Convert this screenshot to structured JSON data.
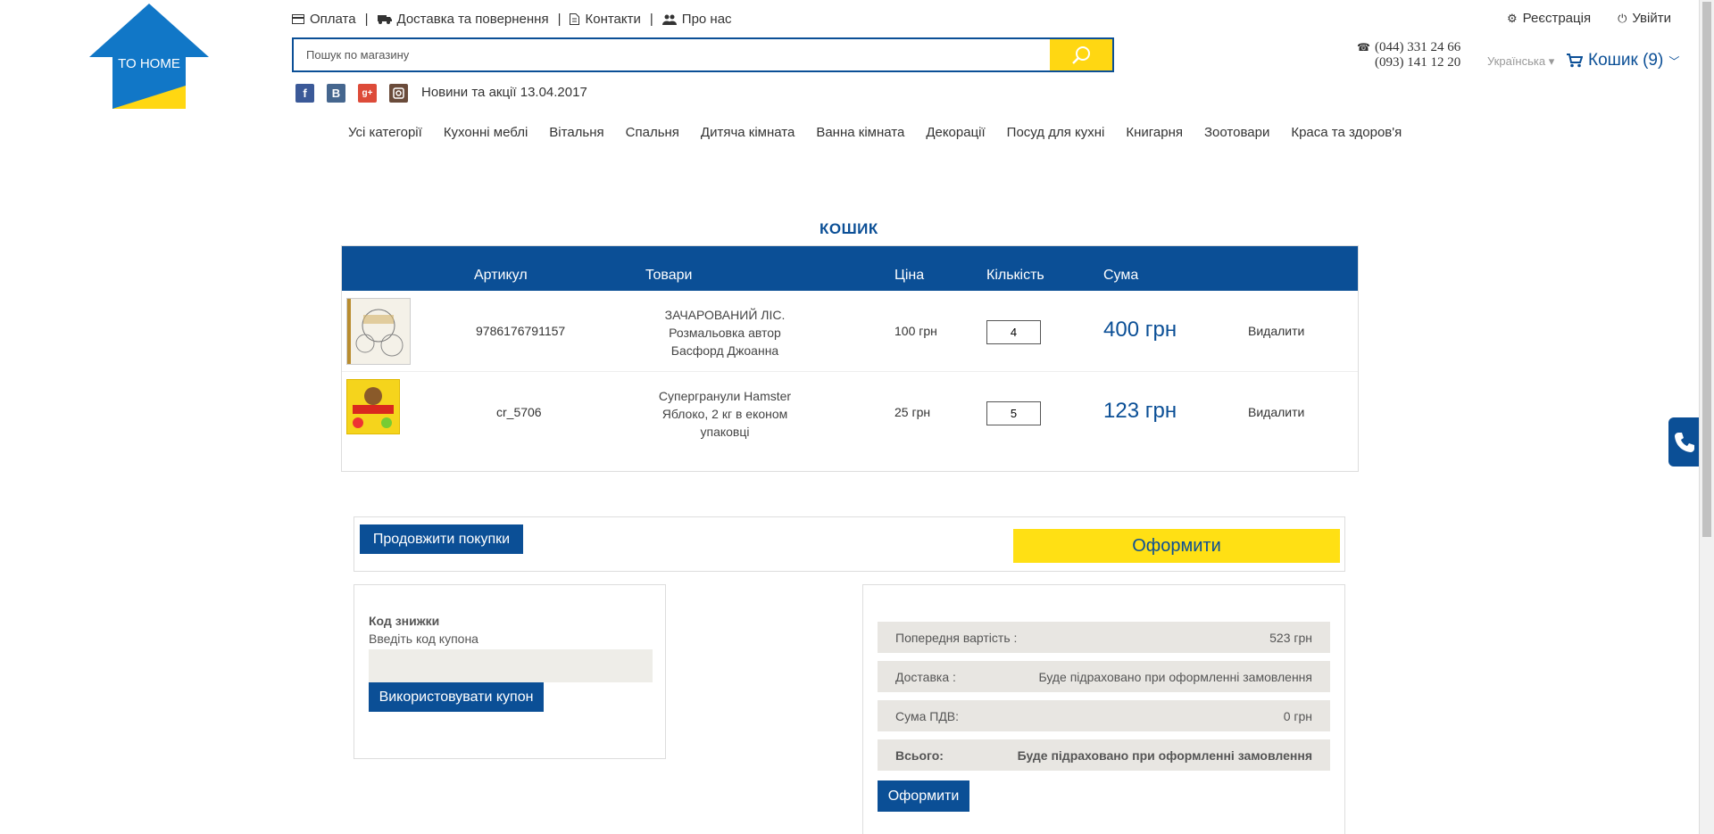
{
  "brand": {
    "logo_text": "TO HOME"
  },
  "top_links": [
    {
      "label": "Оплата",
      "icon": "credit-card-icon"
    },
    {
      "label": "Доставка та повернення",
      "icon": "truck-icon"
    },
    {
      "label": "Контакти",
      "icon": "document-icon"
    },
    {
      "label": "Про нас",
      "icon": "users-icon"
    }
  ],
  "account": {
    "register": "Реєстрація",
    "login": "Увійти"
  },
  "search": {
    "placeholder": "Пошук по магазину"
  },
  "phones": {
    "phone1": "(044) 331 24 66",
    "phone2": "(093) 141 12 20"
  },
  "language": "Українська",
  "cart_link": "Кошик (9)",
  "news": "Новини та акції 13.04.2017",
  "social": [
    "facebook",
    "vkontakte",
    "google-plus",
    "instagram"
  ],
  "categories": [
    "Усі категорії",
    "Кухонні меблі",
    "Вітальня",
    "Спальня",
    "Дитяча кімната",
    "Ванна кімната",
    "Декорації",
    "Посуд для кухні",
    "Книгарня",
    "Зоотовари",
    "Краса та здоров'я"
  ],
  "cart": {
    "title": "КОШИК",
    "headers": {
      "sku": "Артикул",
      "product": "Товари",
      "price": "Ціна",
      "qty": "Кількість",
      "sum": "Сума"
    },
    "items": [
      {
        "sku": "9786176791157",
        "name": "ЗАЧАРОВАНИЙ ЛІС. Розмальовка автор Басфорд Джоанна",
        "price": "100 грн",
        "qty": "4",
        "sum": "400 грн",
        "remove": "Видалити"
      },
      {
        "sku": "cr_5706",
        "name": "Супергранули Hamster Яблоко, 2 кг в економ упаковці",
        "price": "25 грн",
        "qty": "5",
        "sum": "123 грн",
        "remove": "Видалити"
      }
    ]
  },
  "actions": {
    "continue": "Продовжити покупки",
    "checkout": "Оформити"
  },
  "coupon": {
    "label": "Код знижки",
    "hint": "Введіть код купона",
    "button": "Використовувати купон"
  },
  "totals": {
    "rows": [
      {
        "label": "Попередня вартість :",
        "value": "523 грн"
      },
      {
        "label": "Доставка :",
        "value": "Буде підраховано при оформленні замовлення"
      },
      {
        "label": "Сума ПДВ:",
        "value": "0 грн"
      },
      {
        "label": "Всього:",
        "value": "Буде підраховано при оформленні замовлення"
      }
    ],
    "button": "Оформити"
  },
  "colors": {
    "primary": "#0b4f96",
    "accent": "#ffe014"
  }
}
